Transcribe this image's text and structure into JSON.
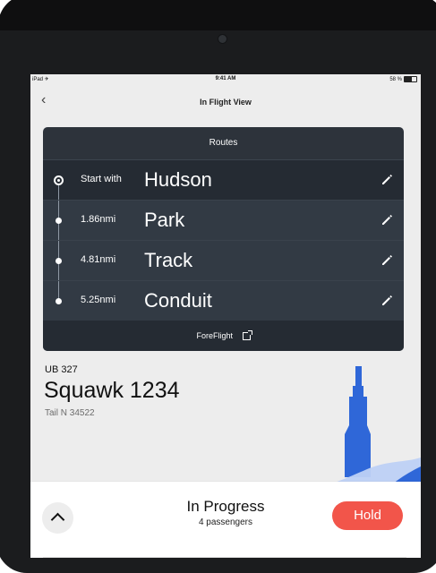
{
  "status": {
    "left": "iPad ✈",
    "time": "9:41 AM",
    "battery": "58 %"
  },
  "nav": {
    "title": "In Flight View"
  },
  "routes": {
    "header": "Routes",
    "items": [
      {
        "distance": "Start with",
        "name": "Hudson"
      },
      {
        "distance": "1.86nmi",
        "name": "Park"
      },
      {
        "distance": "4.81nmi",
        "name": "Track"
      },
      {
        "distance": "5.25nmi",
        "name": "Conduit"
      }
    ],
    "footer": "ForeFlight"
  },
  "flight": {
    "code": "UB 327",
    "squawk": "Squawk 1234",
    "tail": "Tail N 34522"
  },
  "sheet": {
    "title": "In Progress",
    "subtitle": "4 passengers",
    "hold": "Hold"
  },
  "colors": {
    "card": "#2d333b",
    "hold": "#f2554a",
    "blue": "#2f67d8",
    "light_blue": "#9ebbf1"
  }
}
